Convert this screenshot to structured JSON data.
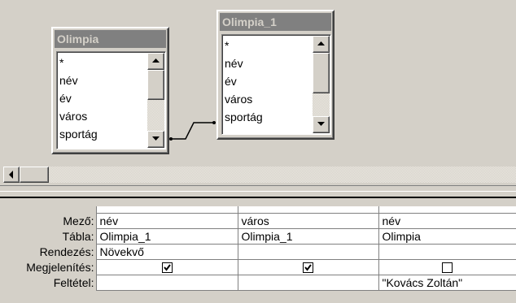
{
  "tables": [
    {
      "title": "Olimpia",
      "fields": [
        "*",
        "név",
        "év",
        "város",
        "sportág"
      ]
    },
    {
      "title": "Olimpia_1",
      "fields": [
        "*",
        "név",
        "év",
        "város",
        "sportág"
      ]
    }
  ],
  "grid": {
    "row_labels": {
      "field": "Mező:",
      "table": "Tábla:",
      "sort": "Rendezés:",
      "show": "Megjelenítés:",
      "criteria": "Feltétel:"
    },
    "columns": [
      {
        "field": "név",
        "table": "Olimpia_1",
        "sort": "Növekvő",
        "show": true,
        "criteria": ""
      },
      {
        "field": "város",
        "table": "Olimpia_1",
        "sort": "",
        "show": true,
        "criteria": ""
      },
      {
        "field": "név",
        "table": "Olimpia",
        "sort": "",
        "show": false,
        "criteria": "\"Kovács Zoltán\""
      }
    ]
  }
}
